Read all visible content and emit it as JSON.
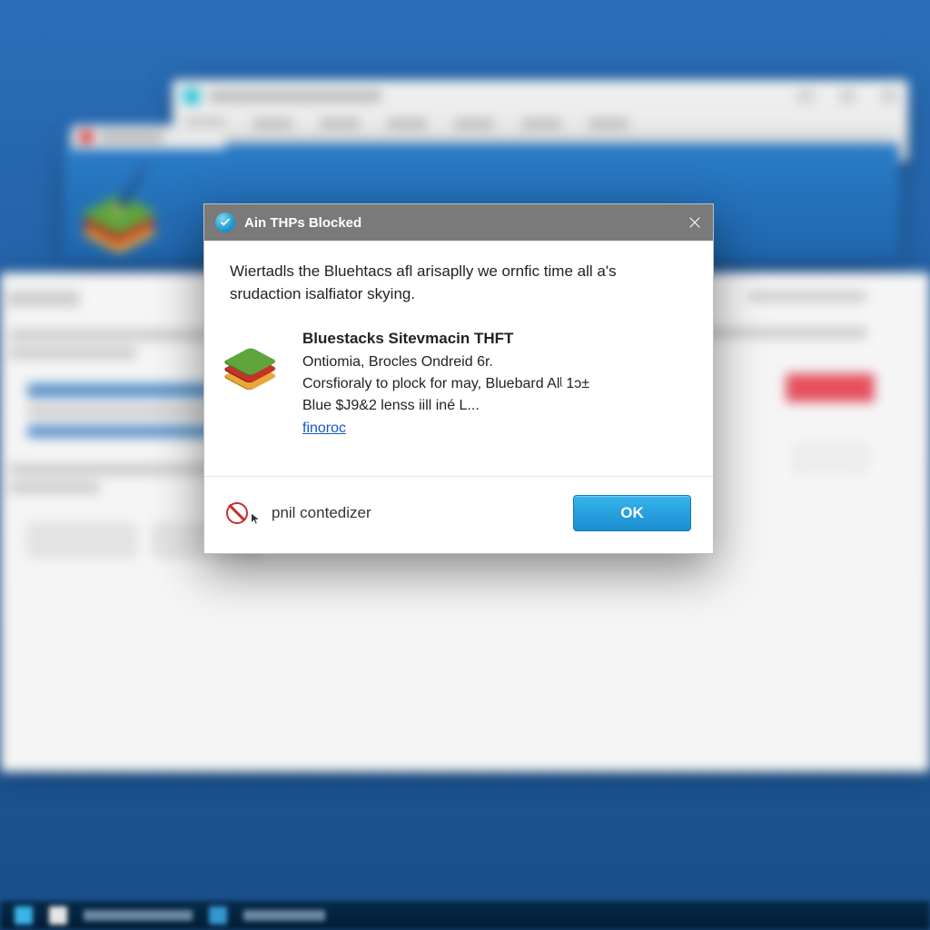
{
  "dialog": {
    "title": "Ain THPs Blocked",
    "intro": "Wiertadls the Bluehtacs afl arisaplly we ornfic time all a's srudaction isalfiator skying.",
    "item": {
      "name": "Bluestacks Sitevmacin THFT",
      "line1": "Ontiomia, Brocles Ondreid 6r.",
      "line2": "Corsfioraly to plock for may, Bluebard Alᶩ 1ɔ±",
      "line3": "Blue $J9&2 lenss iill iné L...",
      "link_label": "finoroc"
    },
    "footer_text": "pnil contedizer",
    "ok_label": "OK"
  },
  "colors": {
    "titlebar_bg": "#7a7a7a",
    "ok_button": "#1a8ed0",
    "link": "#1358c7",
    "block_icon": "#c5302c"
  }
}
